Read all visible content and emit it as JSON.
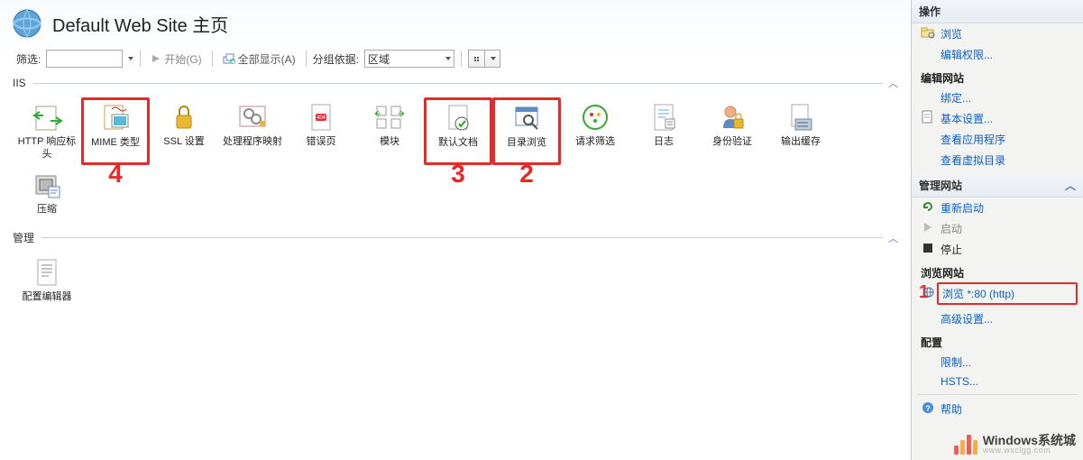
{
  "header": {
    "title": "Default Web Site 主页"
  },
  "toolbar": {
    "filter_label": "筛选:",
    "start_label": "开始(G)",
    "show_all_label": "全部显示(A)",
    "group_by_label": "分组依据:",
    "group_value": "区域"
  },
  "sections": {
    "iis": {
      "title": "IIS",
      "items": [
        {
          "label": "HTTP 响应标头"
        },
        {
          "label": "MIME 类型"
        },
        {
          "label": "SSL 设置"
        },
        {
          "label": "处理程序映射"
        },
        {
          "label": "错误页"
        },
        {
          "label": "模块"
        },
        {
          "label": "默认文档"
        },
        {
          "label": "目录浏览"
        },
        {
          "label": "请求筛选"
        },
        {
          "label": "日志"
        },
        {
          "label": "身份验证"
        },
        {
          "label": "输出缓存"
        },
        {
          "label": "压缩"
        }
      ]
    },
    "mgmt": {
      "title": "管理",
      "items": [
        {
          "label": "配置编辑器"
        }
      ]
    }
  },
  "side": {
    "ops_title": "操作",
    "browse": "浏览",
    "edit_perm": "编辑权限...",
    "edit_site": "编辑网站",
    "binding": "绑定...",
    "basic_settings": "基本设置...",
    "view_apps": "查看应用程序",
    "view_vdirs": "查看虚拟目录",
    "manage_site": "管理网站",
    "restart": "重新启动",
    "start": "启动",
    "stop": "停止",
    "browse_site": "浏览网站",
    "browse_80": "浏览 *:80 (http)",
    "adv_settings": "高级设置...",
    "config": "配置",
    "limits": "限制...",
    "hsts": "HSTS...",
    "help": "帮助"
  },
  "annotations": {
    "n1": "1",
    "n2": "2",
    "n3": "3",
    "n4": "4"
  },
  "watermark": {
    "title": "Windows系统城",
    "url": "www.wxclgg.com"
  }
}
